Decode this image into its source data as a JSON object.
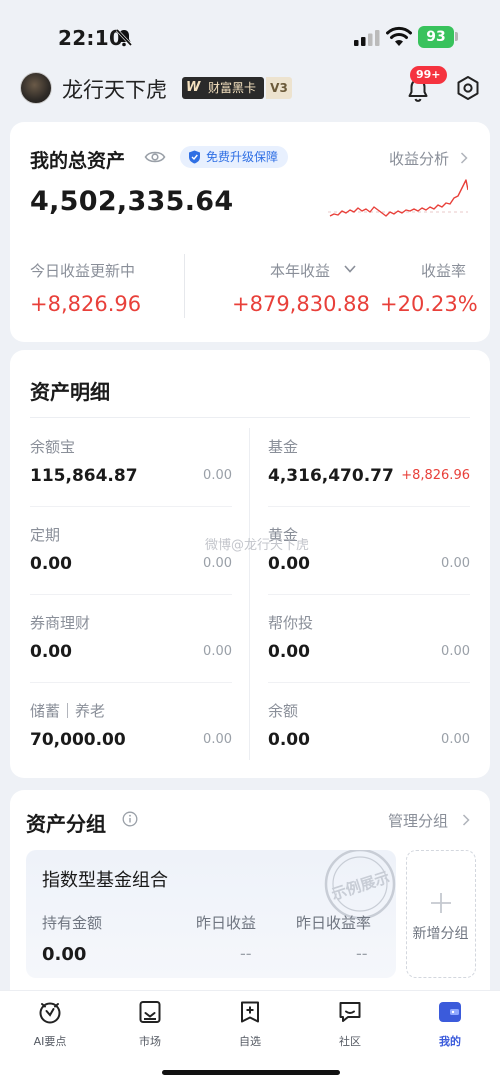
{
  "status_bar": {
    "time": "22:10",
    "battery": "93"
  },
  "user": {
    "name": "龙行天下虎",
    "vip_label": "财富黑卡",
    "vip_logo": "W",
    "level": "V3",
    "message_badge": "99+"
  },
  "summary": {
    "title": "我的总资产",
    "upgrade_label": "免费升级保障",
    "analysis_label": "收益分析",
    "total": "4,502,335.64",
    "today_label": "今日收益更新中",
    "today_value": "+8,826.96",
    "year_label": "本年收益",
    "year_value": "+879,830.88",
    "rate_label": "收益率",
    "rate_value": "+20.23%"
  },
  "details": {
    "title": "资产明细",
    "left": [
      {
        "name": "余额宝",
        "value": "115,864.87",
        "change": "0.00"
      },
      {
        "name": "定期",
        "value": "0.00",
        "change": "0.00"
      },
      {
        "name": "券商理财",
        "value": "0.00",
        "change": "0.00"
      },
      {
        "name": "储蓄｜养老",
        "value": "70,000.00",
        "change": "0.00"
      }
    ],
    "right": [
      {
        "name": "基金",
        "value": "4,316,470.77",
        "change": "+8,826.96"
      },
      {
        "name": "黄金",
        "value": "0.00",
        "change": "0.00"
      },
      {
        "name": "帮你投",
        "value": "0.00",
        "change": "0.00"
      },
      {
        "name": "余额",
        "value": "0.00",
        "change": "0.00"
      }
    ]
  },
  "watermark": "微博@龙行天下虎",
  "groups": {
    "title": "资产分组",
    "manage_label": "管理分组",
    "card_name": "指数型基金组合",
    "stamp_text": "示例展示",
    "col1_label": "持有金额",
    "col1_value": "0.00",
    "col2_label": "昨日收益",
    "col2_value": "--",
    "col3_label": "昨日收益率",
    "col3_value": "--",
    "add_label": "新增分组"
  },
  "tabs": [
    {
      "label": "AI要点"
    },
    {
      "label": "市场"
    },
    {
      "label": "自选"
    },
    {
      "label": "社区"
    },
    {
      "label": "我的"
    }
  ],
  "colors": {
    "positive": "#e8403a",
    "accent": "#3b5bdb",
    "battery": "#38c25c"
  }
}
